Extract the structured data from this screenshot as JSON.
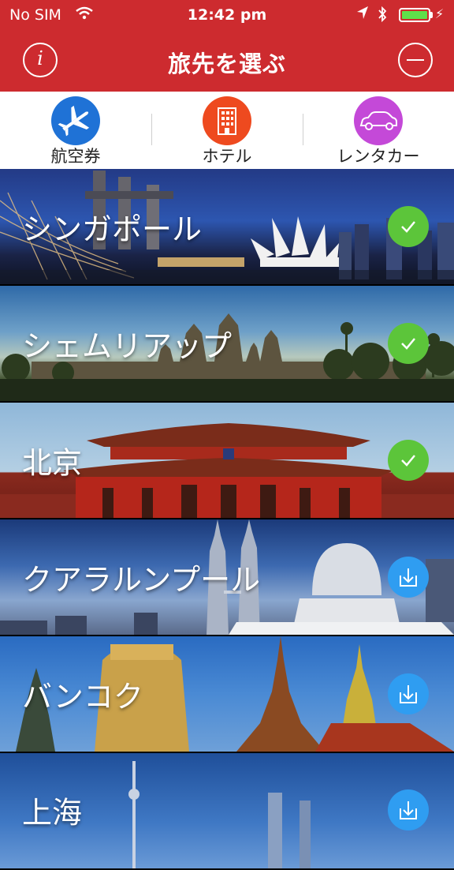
{
  "status_bar": {
    "carrier": "No SIM",
    "time": "12:42 pm",
    "icons": [
      "wifi-icon",
      "location-arrow-icon",
      "bluetooth-icon",
      "battery-icon"
    ]
  },
  "nav": {
    "title": "旅先を選ぶ",
    "left_button_icon": "info-icon",
    "right_button_icon": "minus-circle-icon"
  },
  "tabs": [
    {
      "label": "航空券",
      "icon": "airplane-icon",
      "color": "#1f72d6"
    },
    {
      "label": "ホテル",
      "icon": "building-icon",
      "color": "#ee4a1f"
    },
    {
      "label": "レンタカー",
      "icon": "car-icon",
      "color": "#c449d8"
    }
  ],
  "cities": [
    {
      "name": "シンガポール",
      "state": "downloaded",
      "icon": "check-icon"
    },
    {
      "name": "シェムリアップ",
      "state": "downloaded",
      "icon": "check-icon"
    },
    {
      "name": "北京",
      "state": "downloaded",
      "icon": "check-icon"
    },
    {
      "name": "クアラルンプール",
      "state": "available",
      "icon": "download-icon"
    },
    {
      "name": "バンコク",
      "state": "available",
      "icon": "download-icon"
    },
    {
      "name": "上海",
      "state": "available",
      "icon": "download-icon"
    }
  ],
  "colors": {
    "nav_red": "#cd2b2f",
    "check_green": "#5cc53a",
    "download_blue": "#2f9df1"
  }
}
